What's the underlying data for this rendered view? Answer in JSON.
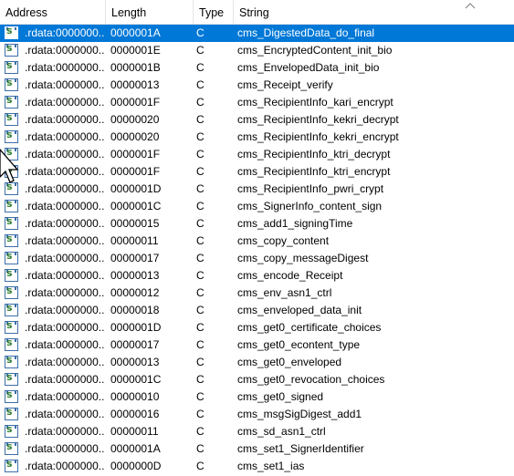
{
  "columns": {
    "address": "Address",
    "length": "Length",
    "type": "Type",
    "string": "String"
  },
  "icon": "string-literal-icon",
  "selected_row": 0,
  "rows": [
    {
      "address": ".rdata:0000000...",
      "length": "0000001A",
      "type": "C",
      "string": "cms_DigestedData_do_final"
    },
    {
      "address": ".rdata:0000000...",
      "length": "0000001E",
      "type": "C",
      "string": "cms_EncryptedContent_init_bio"
    },
    {
      "address": ".rdata:0000000...",
      "length": "0000001B",
      "type": "C",
      "string": "cms_EnvelopedData_init_bio"
    },
    {
      "address": ".rdata:0000000...",
      "length": "00000013",
      "type": "C",
      "string": "cms_Receipt_verify"
    },
    {
      "address": ".rdata:0000000...",
      "length": "0000001F",
      "type": "C",
      "string": "cms_RecipientInfo_kari_encrypt"
    },
    {
      "address": ".rdata:0000000...",
      "length": "00000020",
      "type": "C",
      "string": "cms_RecipientInfo_kekri_decrypt"
    },
    {
      "address": ".rdata:0000000...",
      "length": "00000020",
      "type": "C",
      "string": "cms_RecipientInfo_kekri_encrypt"
    },
    {
      "address": ".rdata:0000000...",
      "length": "0000001F",
      "type": "C",
      "string": "cms_RecipientInfo_ktri_decrypt"
    },
    {
      "address": ".rdata:0000000...",
      "length": "0000001F",
      "type": "C",
      "string": "cms_RecipientInfo_ktri_encrypt"
    },
    {
      "address": ".rdata:0000000...",
      "length": "0000001D",
      "type": "C",
      "string": "cms_RecipientInfo_pwri_crypt"
    },
    {
      "address": ".rdata:0000000...",
      "length": "0000001C",
      "type": "C",
      "string": "cms_SignerInfo_content_sign"
    },
    {
      "address": ".rdata:0000000...",
      "length": "00000015",
      "type": "C",
      "string": "cms_add1_signingTime"
    },
    {
      "address": ".rdata:0000000...",
      "length": "00000011",
      "type": "C",
      "string": "cms_copy_content"
    },
    {
      "address": ".rdata:0000000...",
      "length": "00000017",
      "type": "C",
      "string": "cms_copy_messageDigest"
    },
    {
      "address": ".rdata:0000000...",
      "length": "00000013",
      "type": "C",
      "string": "cms_encode_Receipt"
    },
    {
      "address": ".rdata:0000000...",
      "length": "00000012",
      "type": "C",
      "string": "cms_env_asn1_ctrl"
    },
    {
      "address": ".rdata:0000000...",
      "length": "00000018",
      "type": "C",
      "string": "cms_enveloped_data_init"
    },
    {
      "address": ".rdata:0000000...",
      "length": "0000001D",
      "type": "C",
      "string": "cms_get0_certificate_choices"
    },
    {
      "address": ".rdata:0000000...",
      "length": "00000017",
      "type": "C",
      "string": "cms_get0_econtent_type"
    },
    {
      "address": ".rdata:0000000...",
      "length": "00000013",
      "type": "C",
      "string": "cms_get0_enveloped"
    },
    {
      "address": ".rdata:0000000...",
      "length": "0000001C",
      "type": "C",
      "string": "cms_get0_revocation_choices"
    },
    {
      "address": ".rdata:0000000...",
      "length": "00000010",
      "type": "C",
      "string": "cms_get0_signed"
    },
    {
      "address": ".rdata:0000000...",
      "length": "00000016",
      "type": "C",
      "string": "cms_msgSigDigest_add1"
    },
    {
      "address": ".rdata:0000000...",
      "length": "00000011",
      "type": "C",
      "string": "cms_sd_asn1_ctrl"
    },
    {
      "address": ".rdata:0000000...",
      "length": "0000001A",
      "type": "C",
      "string": "cms_set1_SignerIdentifier"
    },
    {
      "address": ".rdata:0000000...",
      "length": "0000000D",
      "type": "C",
      "string": "cms_set1_ias"
    }
  ]
}
